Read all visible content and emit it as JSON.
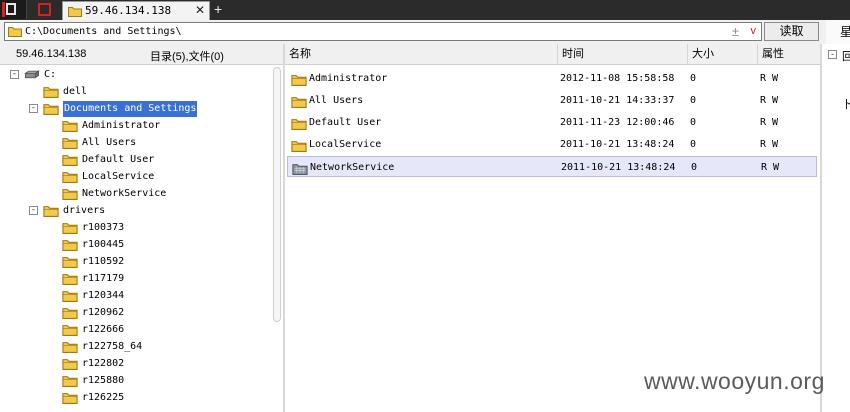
{
  "tabbar": {
    "tab_title": "59.46.134.138",
    "tab_close": "✕",
    "new_tab": "+"
  },
  "address": {
    "path": "C:\\Documents and Settings\\",
    "plus_glyph": "±",
    "dropdown_glyph": "v",
    "read_button": "读取",
    "edge_glyph": "星"
  },
  "left_header": {
    "host": "59.46.134.138",
    "counts": "目录(5),文件(0)"
  },
  "tree": [
    {
      "label": "C:",
      "level": 0,
      "expander": "-",
      "icon": "drive-icon"
    },
    {
      "label": "dell",
      "level": 1,
      "expander": "",
      "icon": "folder-icon"
    },
    {
      "label": "Documents and Settings",
      "level": 1,
      "expander": "-",
      "icon": "folder-icon",
      "selected": true
    },
    {
      "label": "Administrator",
      "level": 2,
      "expander": "",
      "icon": "folder-icon"
    },
    {
      "label": "All Users",
      "level": 2,
      "expander": "",
      "icon": "folder-icon"
    },
    {
      "label": "Default User",
      "level": 2,
      "expander": "",
      "icon": "folder-icon"
    },
    {
      "label": "LocalService",
      "level": 2,
      "expander": "",
      "icon": "folder-icon"
    },
    {
      "label": "NetworkService",
      "level": 2,
      "expander": "",
      "icon": "folder-icon"
    },
    {
      "label": "drivers",
      "level": 1,
      "expander": "-",
      "icon": "folder-icon"
    },
    {
      "label": "r100373",
      "level": 2,
      "expander": "",
      "icon": "folder-icon"
    },
    {
      "label": "r100445",
      "level": 2,
      "expander": "",
      "icon": "folder-icon"
    },
    {
      "label": "r110592",
      "level": 2,
      "expander": "",
      "icon": "folder-icon"
    },
    {
      "label": "r117179",
      "level": 2,
      "expander": "",
      "icon": "folder-icon"
    },
    {
      "label": "r120344",
      "level": 2,
      "expander": "",
      "icon": "folder-icon"
    },
    {
      "label": "r120962",
      "level": 2,
      "expander": "",
      "icon": "folder-icon"
    },
    {
      "label": "r122666",
      "level": 2,
      "expander": "",
      "icon": "folder-icon"
    },
    {
      "label": "r122758_64",
      "level": 2,
      "expander": "",
      "icon": "folder-icon"
    },
    {
      "label": "r122802",
      "level": 2,
      "expander": "",
      "icon": "folder-icon"
    },
    {
      "label": "r125880",
      "level": 2,
      "expander": "",
      "icon": "folder-icon"
    },
    {
      "label": "r126225",
      "level": 2,
      "expander": "",
      "icon": "folder-icon"
    }
  ],
  "columns": [
    "名称",
    "时间",
    "大小",
    "属性"
  ],
  "rows": [
    {
      "name": "Administrator",
      "time": "2012-11-08 15:58:58",
      "size": "0",
      "attr": "R W",
      "icon": "folder-icon"
    },
    {
      "name": "All Users",
      "time": "2011-10-21 14:33:37",
      "size": "0",
      "attr": "R W",
      "icon": "folder-icon"
    },
    {
      "name": "Default User",
      "time": "2011-11-23 12:00:46",
      "size": "0",
      "attr": "R W",
      "icon": "folder-icon"
    },
    {
      "name": "LocalService",
      "time": "2011-10-21 13:48:24",
      "size": "0",
      "attr": "R W",
      "icon": "folder-icon"
    },
    {
      "name": "NetworkService",
      "time": "2011-10-21 13:48:24",
      "size": "0",
      "attr": "R W",
      "icon": "network-folder-icon",
      "selected": true
    }
  ],
  "side_strip": {
    "glyph_top": "回",
    "glyph_mid": "卜"
  },
  "watermark": "www.wooyun.org",
  "colors": {
    "selection": "#3a6fd4",
    "row_highlight": "#e6e8fa",
    "folder": "#f2c94c",
    "tab_bar": "#2b2b2b"
  }
}
